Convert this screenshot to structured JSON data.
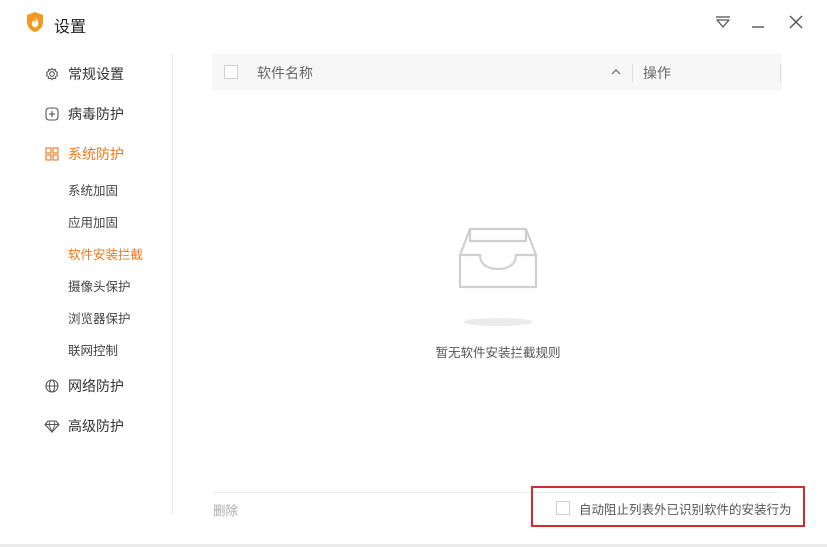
{
  "window": {
    "title": "设置",
    "accent_color": "#e8781a",
    "highlight_color": "#d62b2b"
  },
  "titlebar": {
    "icons": [
      "flame-shield-logo",
      "dropdown-menu-icon",
      "minimize-icon",
      "close-icon"
    ]
  },
  "sidebar": {
    "items": [
      {
        "label": "常规设置",
        "icon": "gear-icon"
      },
      {
        "label": "病毒防护",
        "icon": "plus-box-icon"
      },
      {
        "label": "系统防护",
        "icon": "grid-icon",
        "active": true,
        "children": [
          {
            "label": "系统加固"
          },
          {
            "label": "应用加固"
          },
          {
            "label": "软件安装拦截",
            "active": true
          },
          {
            "label": "摄像头保护"
          },
          {
            "label": "浏览器保护"
          },
          {
            "label": "联网控制"
          }
        ]
      },
      {
        "label": "网络防护",
        "icon": "globe-icon"
      },
      {
        "label": "高级防护",
        "icon": "diamond-icon"
      }
    ]
  },
  "table": {
    "columns": [
      {
        "label": "软件名称",
        "sortable": true
      },
      {
        "label": "操作"
      }
    ],
    "rows": []
  },
  "empty_state": {
    "icon": "empty-tray-icon",
    "message": "暂无软件安装拦截规则"
  },
  "footer": {
    "delete_label": "删除",
    "auto_block_label": "自动阻止列表外已识别软件的安装行为",
    "auto_block_checked": false
  }
}
